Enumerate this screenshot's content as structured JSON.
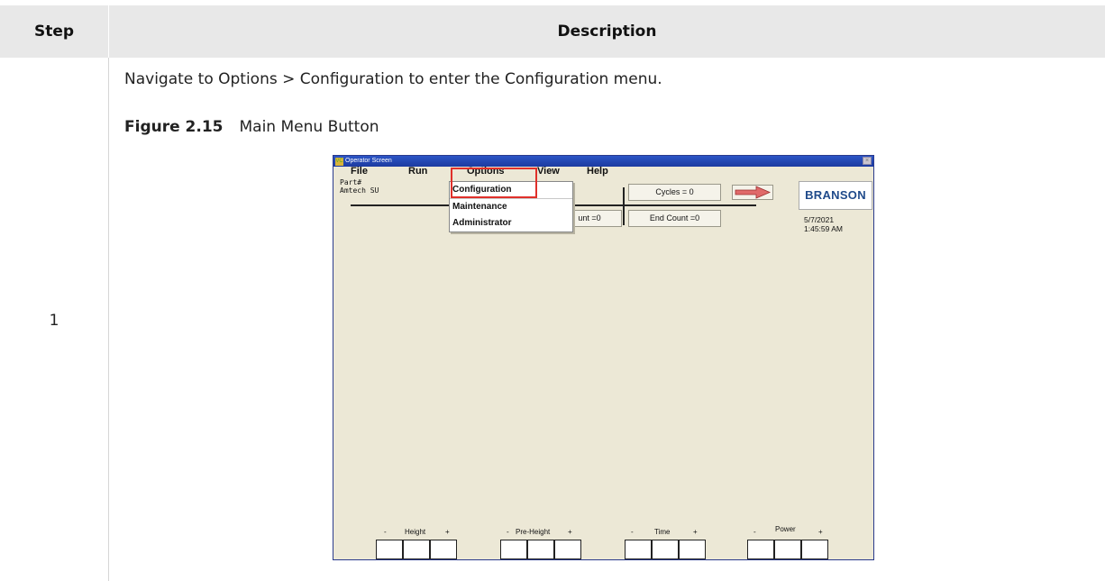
{
  "table": {
    "header_step": "Step",
    "header_description": "Description",
    "step_number": "1",
    "instruction": "Navigate to Options > Configuration to enter the Configuration menu.",
    "figure_label": "Figure 2.15",
    "figure_caption": "Main Menu Button"
  },
  "screen": {
    "window_title": "Operator Screen",
    "app_icon_text": "VC",
    "close_glyph": "×",
    "menu": [
      "File",
      "Run",
      "Options",
      "View",
      "Help"
    ],
    "part_label": "Part#",
    "part_value": "Amtech SU",
    "dropdown_items": [
      "Configuration",
      "Maintenance",
      "Administrator"
    ],
    "count_partial": "unt =0",
    "cycles": "Cycles = 0",
    "end_count": "End Count =0",
    "logo": "BRANSON",
    "date": "5/7/2021",
    "time": "1:45:59 AM",
    "controls": [
      {
        "minus": "-",
        "label": "Height",
        "plus": "+"
      },
      {
        "minus": "-",
        "label": "Pre-Height",
        "plus": "+"
      },
      {
        "minus": "-",
        "label": "Time",
        "plus": "+"
      },
      {
        "minus": "-",
        "label": "Power",
        "plus": "+"
      }
    ],
    "colors": {
      "highlight": "#e0302a",
      "arrow": "#e06a6a",
      "logo": "#1f4a8a",
      "titlebar": "#2c55c6"
    }
  }
}
